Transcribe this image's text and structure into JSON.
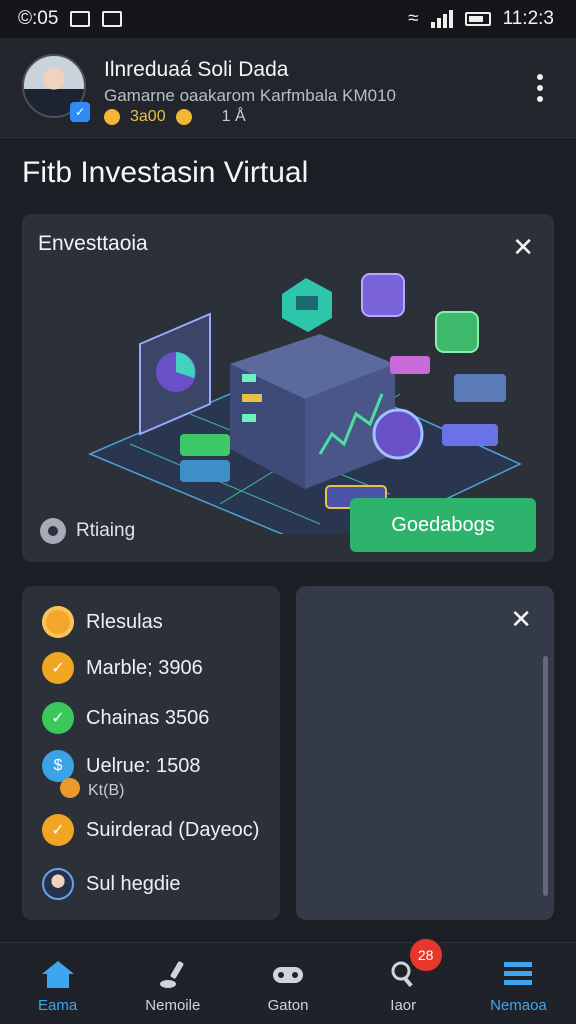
{
  "status_bar": {
    "time": "©:05",
    "clock": "11:2:3"
  },
  "header": {
    "name": "Ilnreduaá Soli Dada",
    "subtitle": "Gamarne oaakarom Karfmbala KM010",
    "coins_label": "3a00",
    "count_label": "1 Å"
  },
  "page_title": "Fitb Investasin Virtual",
  "main_card": {
    "title": "Envesttaoia",
    "ratings_label": "Rtiaing",
    "cta_label": "Goedabogs"
  },
  "results_card": {
    "title": "Rlesulas",
    "rows": [
      {
        "label": "Marble; 3906",
        "color": "#f0a623"
      },
      {
        "label": "Chainas 3506",
        "color": "#3bc85a"
      },
      {
        "label": "Uelrue: 1508",
        "sub": "Kt(B)",
        "color": "#3aa3e8"
      },
      {
        "label": "Suirderad (Dayeoc)",
        "color": "#f0a623"
      },
      {
        "label": "Sul hegdie",
        "color": "#26324a"
      }
    ]
  },
  "nav": {
    "items": [
      {
        "label": "Eama",
        "icon": "home-icon",
        "active": true
      },
      {
        "label": "Nemoile",
        "icon": "brush-icon",
        "active": false
      },
      {
        "label": "Gaton",
        "icon": "gamepad-icon",
        "active": false
      },
      {
        "label": "Iaor",
        "icon": "profile-icon",
        "active": false,
        "badge": "28"
      },
      {
        "label": "Nemaoa",
        "icon": "list-icon",
        "active": true
      }
    ]
  }
}
